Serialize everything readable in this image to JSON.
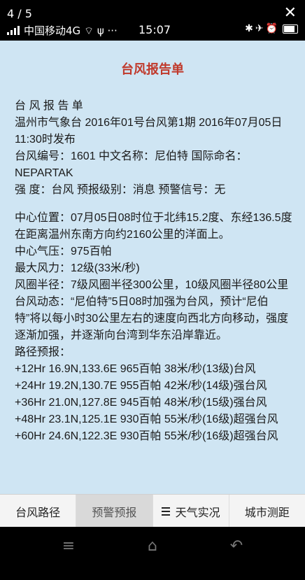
{
  "status": {
    "counter": "4 / 5",
    "carrier": "中国移动4G",
    "carrier_extra": "ψ ···",
    "time": "15:07"
  },
  "report": {
    "title": "台风报告单",
    "lines": [
      "台 风 报 告 单",
      "温州市气象台 2016年01号台风第1期 2016年07月05日11:30时发布",
      "台风编号：1601 中文名称：尼伯特 国际命名：NEPARTAK",
      "强 度：台风 预报级别：消息 预警信号：无",
      "",
      "中心位置：07月05日08时位于北纬15.2度、东经136.5度",
      "在距离温州东南方向约2160公里的洋面上。",
      "中心气压：975百帕",
      "最大风力：12级(33米/秒)",
      "风圈半径：7级风圈半径300公里，10级风圈半径80公里",
      "台风动态：“尼伯特”5日08时加强为台风，预计“尼伯特”将以每小时30公里左右的速度向西北方向移动，强度逐渐加强，并逐渐向台湾到华东沿岸靠近。",
      "路径预报：",
      "+12Hr 16.9N,133.6E 965百帕 38米/秒(13级)台风",
      "+24Hr 19.2N,130.7E 955百帕 42米/秒(14级)强台风",
      "+36Hr 21.0N,127.8E 945百帕 48米/秒(15级)强台风",
      "+48Hr 23.1N,125.1E 930百帕 55米/秒(16级)超强台风",
      "+60Hr 24.6N,122.3E 930百帕 55米/秒(16级)超强台风"
    ]
  },
  "tabs": [
    {
      "label": "台风路径"
    },
    {
      "label": "预警预报"
    },
    {
      "label": "天气实况"
    },
    {
      "label": "城市测距"
    }
  ],
  "nav": {
    "menu_glyph": "≡",
    "home_glyph": "⌂",
    "back_glyph": "↶"
  }
}
